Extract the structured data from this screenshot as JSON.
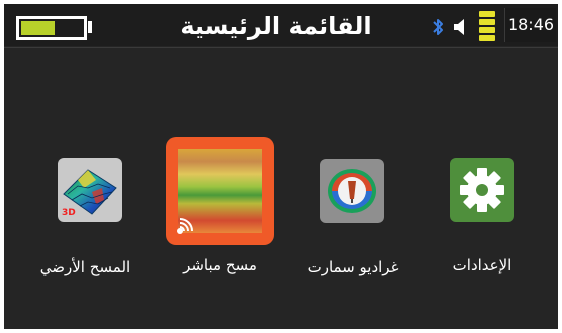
{
  "status_bar": {
    "title": "القائمة الرئيسية",
    "time": "18:46",
    "battery_level": 0.55,
    "icons": [
      "battery-icon",
      "bluetooth-icon",
      "speaker-icon",
      "signal-icon"
    ]
  },
  "apps": [
    {
      "label": "الإعدادات",
      "icon": "gear-icon"
    },
    {
      "label": "غراديو سمارت",
      "icon": "gradio-smart-icon"
    },
    {
      "label": "مسح مباشر",
      "icon": "live-scan-icon"
    },
    {
      "label": "المسح الأرضي",
      "icon": "ground-scan-3d-icon",
      "badge": "3D"
    }
  ],
  "colors": {
    "background": "#252525",
    "battery_fill": "#b8d12a",
    "signal": "#e6e22c",
    "live_scan_accent": "#f05a28",
    "settings_bg": "#4f8f3c"
  }
}
